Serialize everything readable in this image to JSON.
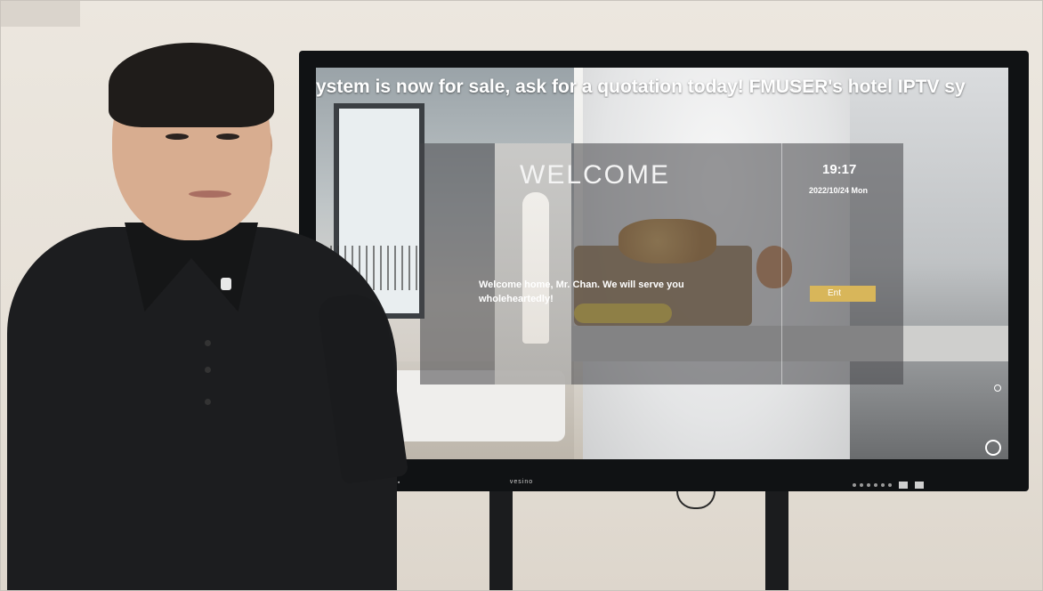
{
  "screen": {
    "marquee_text": "ystem is now for sale, ask for a quotation today! FMUSER's hotel IPTV sy",
    "welcome_title": "WELCOME",
    "clock_time": "19:17",
    "date_text": "2022/10/24 Mon",
    "greeting_text": "Welcome home, Mr. Chan. We will serve you wholeheartedly!",
    "enter_button_label": "Ent"
  },
  "tv": {
    "brand": "vesino"
  }
}
